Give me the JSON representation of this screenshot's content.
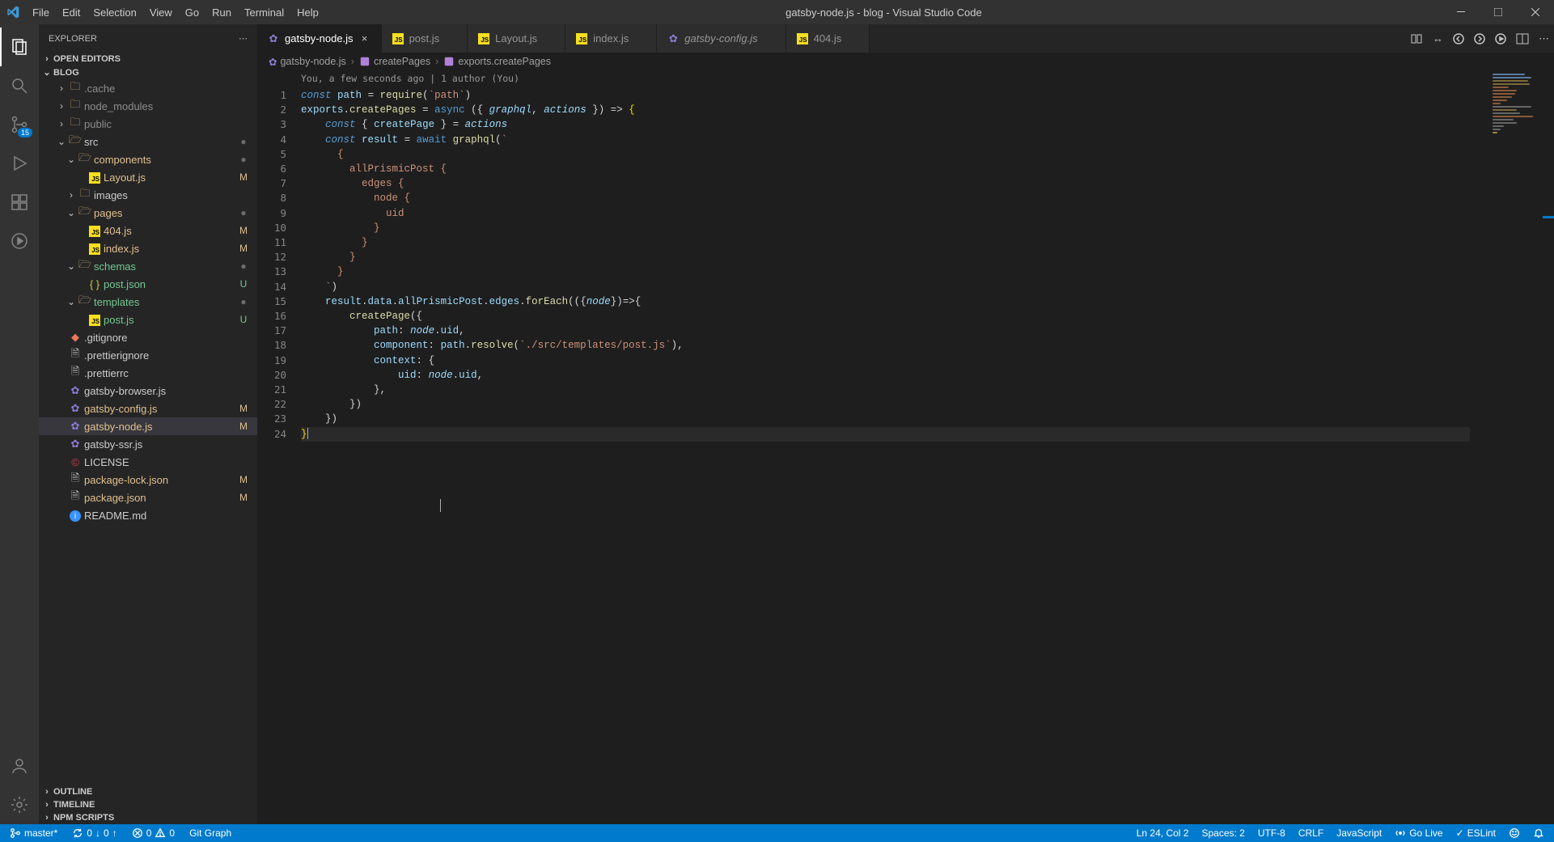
{
  "window": {
    "title": "gatsby-node.js - blog - Visual Studio Code"
  },
  "menu": [
    "File",
    "Edit",
    "Selection",
    "View",
    "Go",
    "Run",
    "Terminal",
    "Help"
  ],
  "activity": {
    "source_control_badge": "15"
  },
  "explorer": {
    "title": "EXPLORER",
    "sections": {
      "open_editors": "OPEN EDITORS",
      "project": "BLOG",
      "outline": "OUTLINE",
      "timeline": "TIMELINE",
      "npm": "NPM SCRIPTS"
    },
    "tree": [
      {
        "indent": 1,
        "chev": ">",
        "icon": "folder",
        "label": ".cache",
        "cls": "row-dim"
      },
      {
        "indent": 1,
        "chev": ">",
        "icon": "folder",
        "label": "node_modules",
        "cls": "row-dim"
      },
      {
        "indent": 1,
        "chev": ">",
        "icon": "folder",
        "label": "public",
        "cls": "row-dim"
      },
      {
        "indent": 1,
        "chev": "v",
        "icon": "folder-open",
        "label": "src",
        "status": "",
        "statusCls": "mod-dot",
        "statusChar": "●"
      },
      {
        "indent": 2,
        "chev": "v",
        "icon": "folder-open",
        "label": "components",
        "cls": "row-mod",
        "status": "",
        "statusCls": "mod-dot",
        "statusChar": "●"
      },
      {
        "indent": 3,
        "chev": "",
        "icon": "js",
        "label": "Layout.js",
        "cls": "row-mod",
        "status": "M",
        "statusCls": "row-mod"
      },
      {
        "indent": 2,
        "chev": ">",
        "icon": "folder",
        "label": "images"
      },
      {
        "indent": 2,
        "chev": "v",
        "icon": "folder-open",
        "label": "pages",
        "cls": "row-mod",
        "status": "",
        "statusCls": "mod-dot",
        "statusChar": "●"
      },
      {
        "indent": 3,
        "chev": "",
        "icon": "js",
        "label": "404.js",
        "cls": "row-mod",
        "status": "M",
        "statusCls": "row-mod"
      },
      {
        "indent": 3,
        "chev": "",
        "icon": "js",
        "label": "index.js",
        "cls": "row-mod",
        "status": "M",
        "statusCls": "row-mod"
      },
      {
        "indent": 2,
        "chev": "v",
        "icon": "folder-open",
        "label": "schemas",
        "cls": "row-new",
        "status": "",
        "statusCls": "mod-dot",
        "statusChar": "●"
      },
      {
        "indent": 3,
        "chev": "",
        "icon": "json",
        "label": "post.json",
        "cls": "row-new",
        "status": "U",
        "statusCls": "row-new"
      },
      {
        "indent": 2,
        "chev": "v",
        "icon": "folder-open",
        "label": "templates",
        "cls": "row-new",
        "status": "",
        "statusCls": "mod-dot",
        "statusChar": "●"
      },
      {
        "indent": 3,
        "chev": "",
        "icon": "js",
        "label": "post.js",
        "cls": "row-new",
        "status": "U",
        "statusCls": "row-new"
      },
      {
        "indent": 1,
        "chev": "",
        "icon": "git",
        "label": ".gitignore"
      },
      {
        "indent": 1,
        "chev": "",
        "icon": "file",
        "label": ".prettierignore"
      },
      {
        "indent": 1,
        "chev": "",
        "icon": "file",
        "label": ".prettierrc"
      },
      {
        "indent": 1,
        "chev": "",
        "icon": "config",
        "label": "gatsby-browser.js"
      },
      {
        "indent": 1,
        "chev": "",
        "icon": "config",
        "label": "gatsby-config.js",
        "cls": "row-mod",
        "status": "M",
        "statusCls": "row-mod"
      },
      {
        "indent": 1,
        "chev": "",
        "icon": "config",
        "label": "gatsby-node.js",
        "cls": "row-mod",
        "status": "M",
        "statusCls": "row-mod",
        "active": true
      },
      {
        "indent": 1,
        "chev": "",
        "icon": "config",
        "label": "gatsby-ssr.js"
      },
      {
        "indent": 1,
        "chev": "",
        "icon": "license",
        "label": "LICENSE"
      },
      {
        "indent": 1,
        "chev": "",
        "icon": "file",
        "label": "package-lock.json",
        "cls": "row-mod",
        "status": "M",
        "statusCls": "row-mod"
      },
      {
        "indent": 1,
        "chev": "",
        "icon": "file",
        "label": "package.json",
        "cls": "row-mod",
        "status": "M",
        "statusCls": "row-mod"
      },
      {
        "indent": 1,
        "chev": "",
        "icon": "info",
        "label": "README.md"
      }
    ]
  },
  "tabs": [
    {
      "icon": "config",
      "label": "gatsby-node.js",
      "active": true,
      "close": true
    },
    {
      "icon": "js",
      "label": "post.js"
    },
    {
      "icon": "js",
      "label": "Layout.js"
    },
    {
      "icon": "js",
      "label": "index.js"
    },
    {
      "icon": "config",
      "label": "gatsby-config.js",
      "italic": true
    },
    {
      "icon": "js",
      "label": "404.js"
    }
  ],
  "breadcrumbs": [
    {
      "icon": "config",
      "label": "gatsby-node.js"
    },
    {
      "icon": "method",
      "label": "createPages"
    },
    {
      "icon": "method",
      "label": "exports.createPages"
    }
  ],
  "codelens": "You, a few seconds ago | 1 author (You)",
  "status": {
    "branch": "master*",
    "sync_up": "0",
    "sync_down": "0",
    "errors": "0",
    "warnings": "0",
    "git_graph": "Git Graph",
    "position": "Ln 24, Col 2",
    "spaces": "Spaces: 2",
    "encoding": "UTF-8",
    "eol": "CRLF",
    "language": "JavaScript",
    "golive": "Go Live",
    "eslint": "ESLint",
    "feedback": "",
    "bell": ""
  }
}
